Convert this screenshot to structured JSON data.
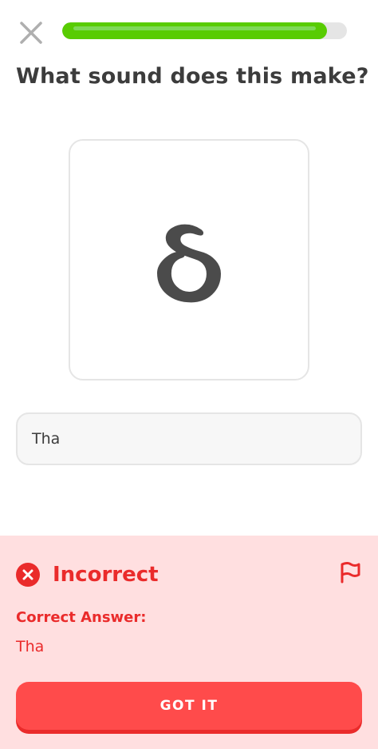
{
  "progress": {
    "value": 0.93
  },
  "prompt": {
    "text": "What sound does this make?"
  },
  "character": {
    "glyph": "ઠ"
  },
  "answer": {
    "value": "Tha"
  },
  "feedback": {
    "status": "Incorrect",
    "correct_label": "Correct Answer:",
    "correct_value": "Tha",
    "button_label": "GOT IT"
  },
  "icons": {
    "close": "close-icon",
    "status": "x-circle-icon",
    "report": "flag-icon"
  },
  "colors": {
    "progress_green": "#58cc02",
    "error_red": "#ea2b2b",
    "feedback_bg": "#ffdfe0",
    "button_red": "#ff4b4b"
  }
}
